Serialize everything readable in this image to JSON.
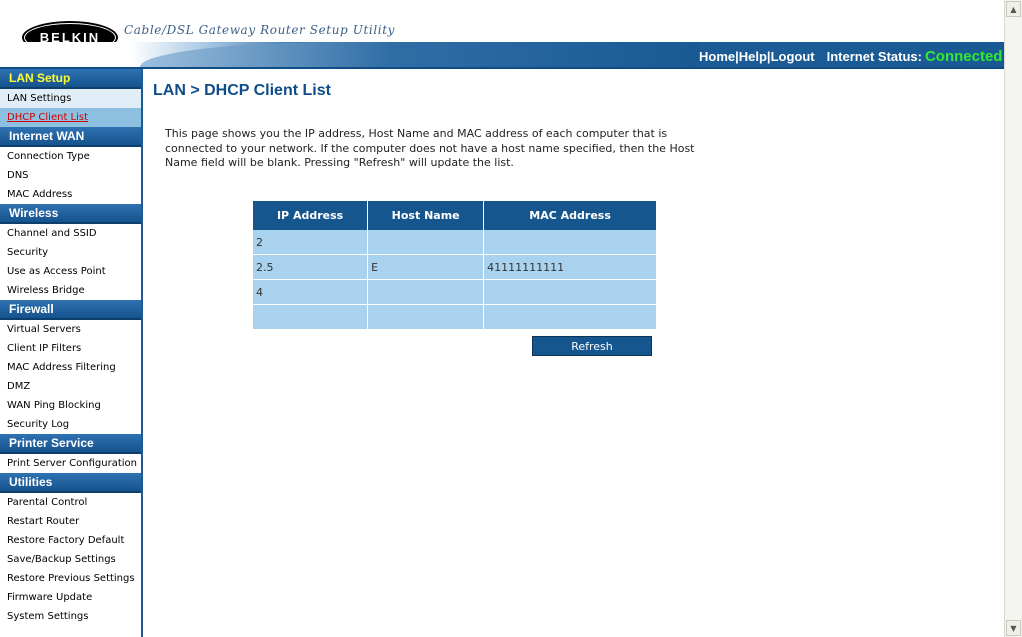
{
  "header": {
    "brand": "BELKIN",
    "tagline": "Cable/DSL Gateway Router Setup Utility",
    "links": [
      "Home|",
      "Help|",
      "Logout"
    ],
    "internet_status_label": "Internet Status:",
    "internet_status_value": "Connected",
    "status_color": "#33e833"
  },
  "sidebar": {
    "sections": [
      {
        "title": "LAN Setup",
        "items": [
          "LAN Settings",
          "DHCP Client List"
        ]
      },
      {
        "title": "Internet WAN",
        "items": [
          "Connection Type",
          "DNS",
          "MAC Address"
        ]
      },
      {
        "title": "Wireless",
        "items": [
          "Channel and SSID",
          "Security",
          "Use as Access Point",
          "Wireless Bridge"
        ]
      },
      {
        "title": "Firewall",
        "items": [
          "Virtual Servers",
          "Client IP Filters",
          "MAC Address Filtering",
          "DMZ",
          "WAN Ping Blocking",
          "Security Log"
        ]
      },
      {
        "title": "Printer Service",
        "items": [
          "Print Server Configuration"
        ]
      },
      {
        "title": "Utilities",
        "items": [
          "Parental Control",
          "Restart Router",
          "Restore Factory Default",
          "Save/Backup Settings",
          "Restore Previous Settings",
          "Firmware Update",
          "System Settings"
        ]
      }
    ]
  },
  "main": {
    "title": "LAN > DHCP Client List",
    "description": "This page shows you the IP address, Host Name and MAC address of each computer that is connected to your network. If the computer does not have a host name specified, then the Host Name field will be blank. Pressing \"Refresh\" will update the list.",
    "table": {
      "headers": [
        "IP Address",
        "Host Name",
        "MAC Address"
      ],
      "rows": [
        [
          "2",
          "",
          ""
        ],
        [
          "2.5",
          "E",
          "41111111111"
        ],
        [
          "4",
          "",
          ""
        ],
        [
          "",
          "",
          ""
        ]
      ]
    },
    "refresh_label": "Refresh"
  },
  "colors": {
    "accent": "#16568e",
    "table_cell": "#a9d2ee",
    "active_link": "#d40000"
  }
}
